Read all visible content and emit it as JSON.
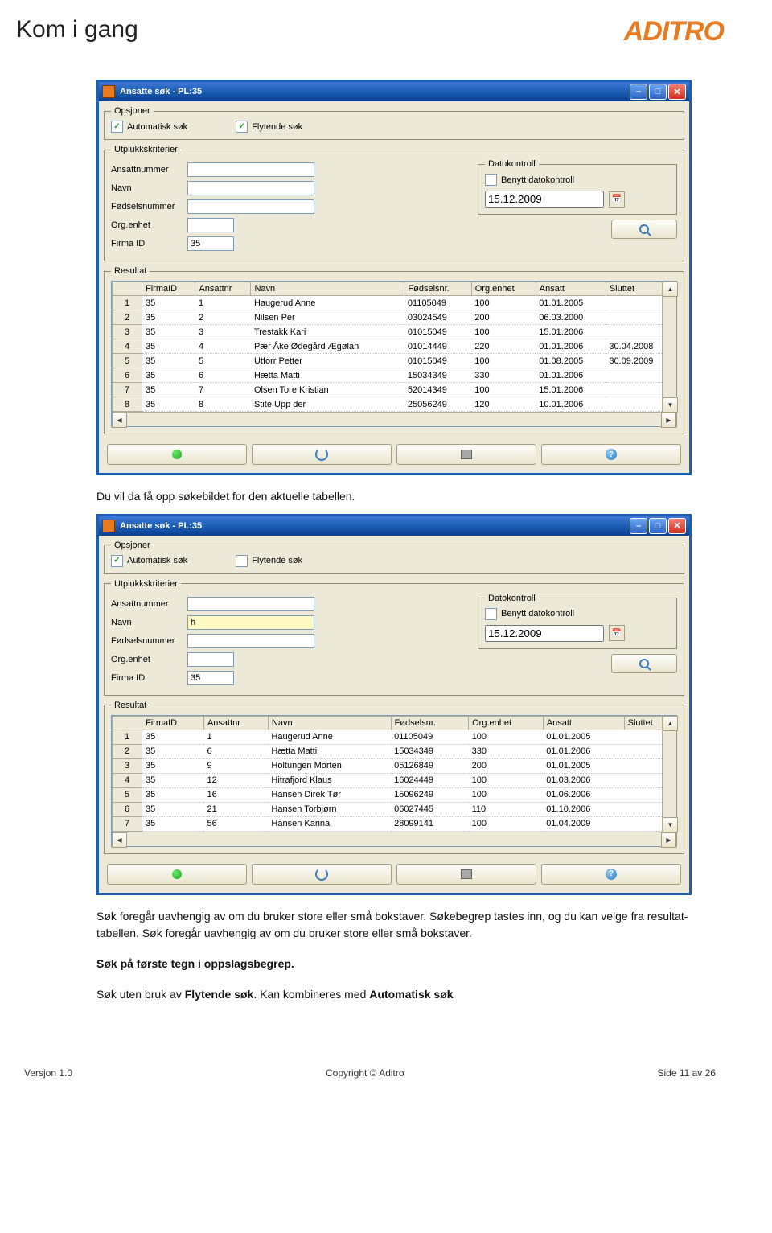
{
  "page_title": "Kom i gang",
  "brand": "ADITRO",
  "window_title": "Ansatte søk - PL:35",
  "opsjoner": {
    "legend": "Opsjoner",
    "auto_label": "Automatisk søk",
    "flyt_label": "Flytende søk"
  },
  "criteria": {
    "legend": "Utplukkskriterier",
    "ansattnummer": "Ansattnummer",
    "navn": "Navn",
    "fodselsnummer": "Fødselsnummer",
    "orgenhet": "Org.enhet",
    "firmaid": "Firma ID",
    "firmaid_val": "35"
  },
  "dato": {
    "legend": "Datokontroll",
    "benytt_label": "Benytt datokontroll",
    "value": "15.12.2009"
  },
  "result_legend": "Resultat",
  "cols": [
    "FirmaID",
    "Ansattnr",
    "Navn",
    "Fødselsnr.",
    "Org.enhet",
    "Ansatt",
    "Sluttet"
  ],
  "rows1": [
    [
      "1",
      "35",
      "1",
      "Haugerud Anne",
      "01105049",
      "100",
      "01.01.2005",
      ""
    ],
    [
      "2",
      "35",
      "2",
      "Nilsen Per",
      "03024549",
      "200",
      "06.03.2000",
      ""
    ],
    [
      "3",
      "35",
      "3",
      "Trestakk Kari",
      "01015049",
      "100",
      "15.01.2006",
      ""
    ],
    [
      "4",
      "35",
      "4",
      "Pær Åke Ødegård Ægølan",
      "01014449",
      "220",
      "01.01.2006",
      "30.04.2008"
    ],
    [
      "5",
      "35",
      "5",
      "Utforr Petter",
      "01015049",
      "100",
      "01.08.2005",
      "30.09.2009"
    ],
    [
      "6",
      "35",
      "6",
      "Hætta Matti",
      "15034349",
      "330",
      "01.01.2006",
      ""
    ],
    [
      "7",
      "35",
      "7",
      "Olsen Tore Kristian",
      "52014349",
      "100",
      "15.01.2006",
      ""
    ],
    [
      "8",
      "35",
      "8",
      "Stite Upp der",
      "25056249",
      "120",
      "10.01.2006",
      ""
    ]
  ],
  "navn2_val": "h",
  "rows2": [
    [
      "1",
      "35",
      "1",
      "Haugerud Anne",
      "01105049",
      "100",
      "01.01.2005",
      ""
    ],
    [
      "2",
      "35",
      "6",
      "Hætta Matti",
      "15034349",
      "330",
      "01.01.2006",
      ""
    ],
    [
      "3",
      "35",
      "9",
      "Holtungen Morten",
      "05126849",
      "200",
      "01.01.2005",
      ""
    ],
    [
      "4",
      "35",
      "12",
      "Hitrafjord Klaus",
      "16024449",
      "100",
      "01.03.2006",
      ""
    ],
    [
      "5",
      "35",
      "16",
      "Hansen Direk Tør",
      "15096249",
      "100",
      "01.06.2006",
      ""
    ],
    [
      "6",
      "35",
      "21",
      "Hansen Torbjørn",
      "06027445",
      "110",
      "01.10.2006",
      ""
    ],
    [
      "7",
      "35",
      "56",
      "Hansen Karina",
      "28099141",
      "100",
      "01.04.2009",
      ""
    ]
  ],
  "text": {
    "p1": "Du vil da få opp søkebildet for den aktuelle tabellen.",
    "p2": "Søk foregår uavhengig av om du bruker store eller små bokstaver. Søkebegrep tastes inn, og du kan velge fra resultat-tabellen. Søk foregår uavhengig av om du bruker store eller små bokstaver.",
    "p3": "Søk på første tegn i oppslagsbegrep.",
    "p4a": "Søk uten bruk av ",
    "p4b": "Flytende søk",
    "p4c": ". Kan kombineres med ",
    "p4d": "Automatisk søk"
  },
  "footer": {
    "left": "Versjon 1.0",
    "center": "Copyright © Aditro",
    "right": "Side 11 av 26"
  }
}
